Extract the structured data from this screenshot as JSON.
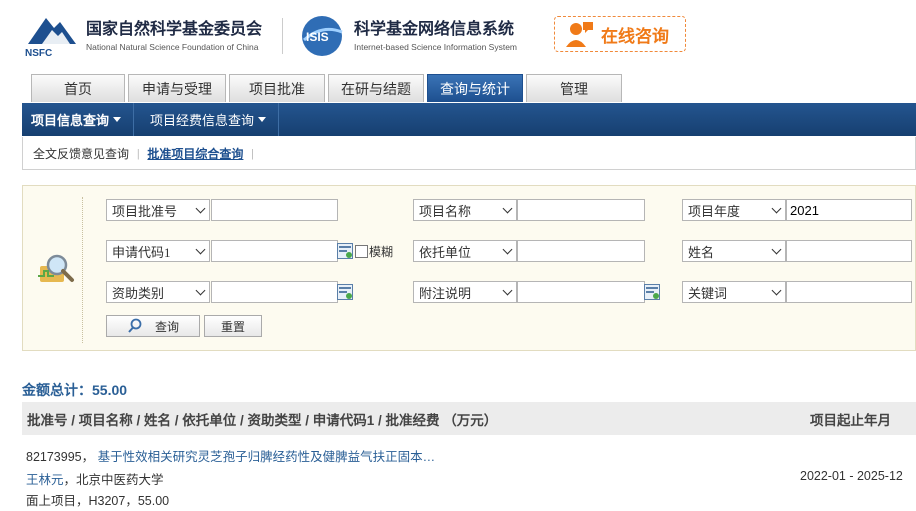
{
  "header": {
    "nsfc_logo_text": "NSFC",
    "nsfc_cn": "国家自然科学基金委员会",
    "nsfc_en": "National Natural Science Foundation of China",
    "isis_logo_text": "ISIS",
    "isis_cn": "科学基金网络信息系统",
    "isis_en": "Internet-based Science Information System",
    "consult_label": "在线咨询"
  },
  "tabs": [
    {
      "label": "首页"
    },
    {
      "label": "申请与受理"
    },
    {
      "label": "项目批准"
    },
    {
      "label": "在研与结题"
    },
    {
      "label": "查询与统计"
    },
    {
      "label": "管理"
    }
  ],
  "navbar": {
    "item1": "项目信息查询",
    "item2": "项目经费信息查询"
  },
  "subnav": {
    "item1": "全文反馈意见查询",
    "item2": "批准项目综合查询"
  },
  "search": {
    "row1": {
      "sel1": "项目批准号",
      "sel2": "项目名称",
      "sel3": "项目年度",
      "val3": "2021"
    },
    "row2": {
      "sel1": "申请代码1",
      "fuzzy": "模糊",
      "sel2": "依托单位",
      "sel3": "姓名"
    },
    "row3": {
      "sel1": "资助类别",
      "sel2": "附注说明",
      "sel3": "关键词"
    },
    "query_btn": "查询",
    "reset_btn": "重置"
  },
  "results": {
    "total_label": "金额总计：55.00",
    "header_cols": "批准号 / 项目名称 / 姓名 / 依托单位 / 资助类型 / 申请代码1 / 批准经费 （万元）",
    "header_right": "项目起止年月",
    "rows": [
      {
        "id": "82173995，",
        "title": "基于性效相关研究灵芝孢子归脾经药性及健脾益气扶正固本…",
        "person": "王林元",
        "org": "，北京中医药大学",
        "meta": "面上项目，H3207，55.00",
        "period": "2022-01 - 2025-12"
      }
    ]
  },
  "colors": {
    "accent": "#1d4f8f",
    "link": "#2a5f96",
    "orange": "#f07a18"
  }
}
